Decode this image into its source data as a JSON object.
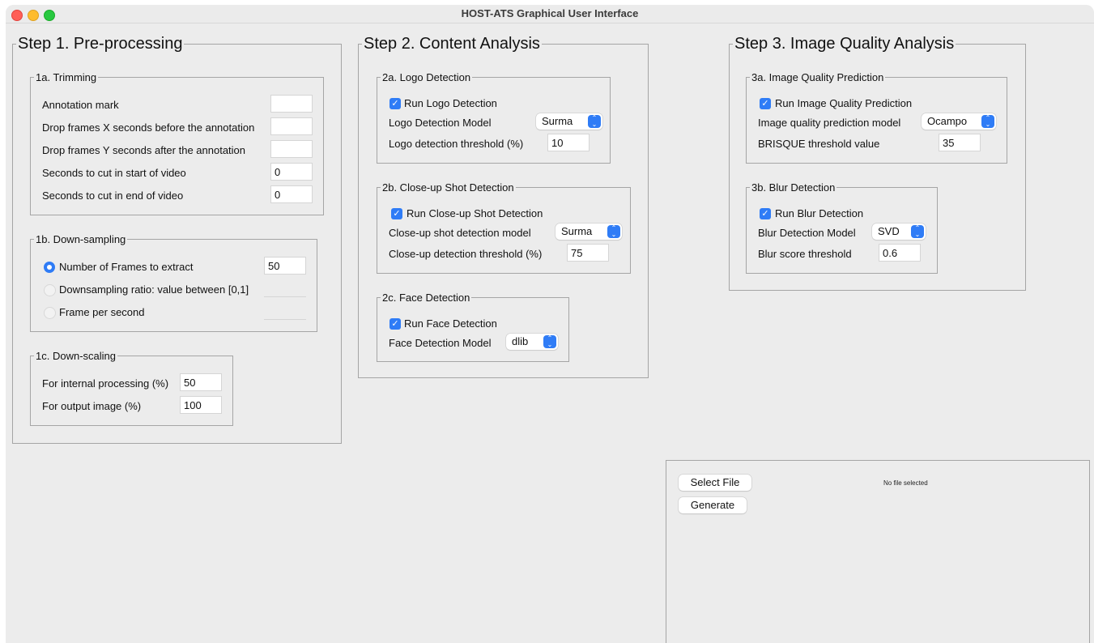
{
  "window": {
    "title": "HOST-ATS Graphical User Interface"
  },
  "step1": {
    "title": "Step 1. Pre-processing",
    "trimming": {
      "title": "1a. Trimming",
      "rows": [
        {
          "label": "Annotation mark",
          "value": ""
        },
        {
          "label": "Drop frames X seconds before the annotation",
          "value": ""
        },
        {
          "label": "Drop frames Y seconds after the annotation",
          "value": ""
        },
        {
          "label": "Seconds to cut in start of video",
          "value": "0"
        },
        {
          "label": "Seconds to cut in end of video",
          "value": "0"
        }
      ]
    },
    "downsampling": {
      "title": "1b. Down-sampling",
      "options": [
        {
          "label": "Number of Frames to extract",
          "value": "50",
          "selected": true
        },
        {
          "label": "Downsampling ratio: value between [0,1]",
          "value": "",
          "selected": false
        },
        {
          "label": "Frame per second",
          "value": "",
          "selected": false
        }
      ]
    },
    "downscaling": {
      "title": "1c. Down-scaling",
      "rows": [
        {
          "label": "For internal processing (%)",
          "value": "50"
        },
        {
          "label": "For output image (%)",
          "value": "100"
        }
      ]
    }
  },
  "step2": {
    "title": "Step 2. Content Analysis",
    "logo": {
      "title": "2a. Logo Detection",
      "checkbox_label": "Run Logo Detection",
      "checked": true,
      "model_label": "Logo Detection Model",
      "model_value": "Surma",
      "threshold_label": "Logo detection threshold (%)",
      "threshold_value": "10"
    },
    "closeup": {
      "title": "2b. Close-up Shot Detection",
      "checkbox_label": "Run Close-up Shot Detection",
      "checked": true,
      "model_label": "Close-up shot detection model",
      "model_value": "Surma",
      "threshold_label": "Close-up detection threshold (%)",
      "threshold_value": "75"
    },
    "face": {
      "title": "2c. Face Detection",
      "checkbox_label": "Run Face Detection",
      "checked": true,
      "model_label": "Face Detection Model",
      "model_value": "dlib"
    }
  },
  "step3": {
    "title": "Step 3. Image Quality Analysis",
    "iqp": {
      "title": "3a. Image Quality Prediction",
      "checkbox_label": "Run Image Quality Prediction",
      "checked": true,
      "model_label": "Image quality prediction model",
      "model_value": "Ocampo",
      "threshold_label": "BRISQUE threshold value",
      "threshold_value": "35"
    },
    "blur": {
      "title": "3b. Blur Detection",
      "checkbox_label": "Run Blur Detection",
      "checked": true,
      "model_label": "Blur Detection Model",
      "model_value": "SVD",
      "threshold_label": "Blur score threshold",
      "threshold_value": "0.6"
    }
  },
  "actions": {
    "select_file_label": "Select File",
    "generate_label": "Generate",
    "file_status": "No file selected"
  },
  "icons": {
    "checkbox": "checkmark-icon",
    "combo": "updown-chevron-icon",
    "accent_color": "#2f7cf6"
  }
}
